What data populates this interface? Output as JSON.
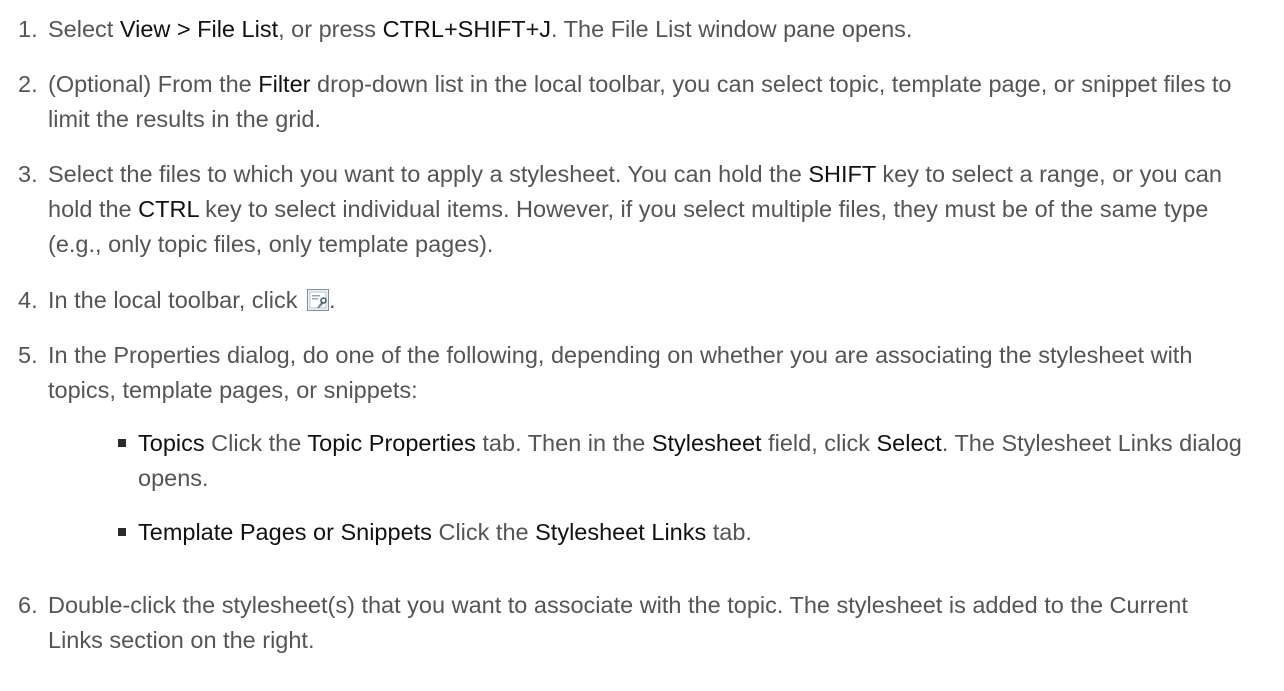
{
  "steps": [
    {
      "number": "1.",
      "parts": [
        "Select ",
        "View > File List",
        ", or press ",
        "CTRL+SHIFT+J",
        ". The File List window pane opens."
      ]
    },
    {
      "number": "2.",
      "parts": [
        "(Optional) From the ",
        "Filter",
        " drop-down list in the local toolbar, you can select topic, template page, or snippet files to limit the results in the grid."
      ]
    },
    {
      "number": "3.",
      "parts": [
        "Select the files to which you want to apply a stylesheet. You can hold the ",
        "SHIFT",
        " key to select a range, or you can hold the ",
        "CTRL",
        " key to select individual items. However, if you select multiple files, they must be of the same type (e.g., only topic files, only template pages)."
      ]
    },
    {
      "number": "4.",
      "parts": [
        "In the local toolbar, click ",
        "."
      ],
      "icon": "properties-icon"
    },
    {
      "number": "5.",
      "parts": [
        "In the Properties dialog, do one of the following, depending on whether you are associating the stylesheet with topics, template pages, or snippets:"
      ]
    },
    {
      "number": "6.",
      "parts": [
        "Double-click the stylesheet(s) that you want to associate with the topic. The stylesheet is added to the Current Links section on the right."
      ]
    }
  ],
  "bullets": [
    {
      "parts": [
        "Topics",
        " Click the ",
        "Topic Properties",
        " tab. Then in the ",
        "Stylesheet",
        " field, click ",
        "Select",
        ". The Stylesheet Links dialog opens."
      ]
    },
    {
      "parts": [
        "Template Pages or Snippets",
        " Click the ",
        "Stylesheet Links",
        " tab."
      ]
    }
  ]
}
